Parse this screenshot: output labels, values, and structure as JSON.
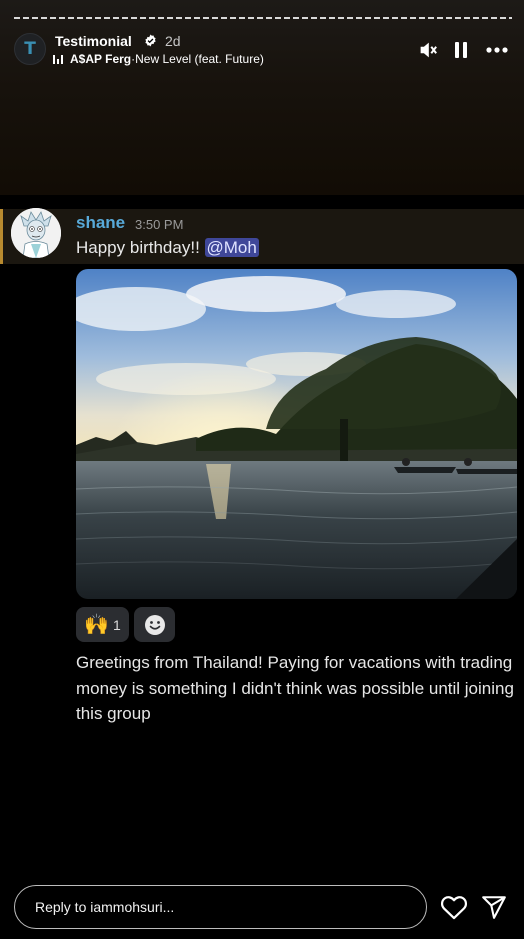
{
  "story": {
    "account_name": "Testimonial",
    "posted_ago": "2d",
    "avatar_letter": "T",
    "music": {
      "artist": "A$AP Ferg",
      "separator": " · ",
      "song": "New Level (feat. Future)"
    },
    "icons": [
      "mute-icon",
      "pause-icon",
      "more-icon"
    ]
  },
  "message": {
    "username": "shane",
    "timestamp": "3:50 PM",
    "text": "Happy birthday!! ",
    "mention": "@Moh",
    "reactions": [
      {
        "emoji": "🙌",
        "count": "1"
      },
      {
        "icon": "add-reaction-icon"
      }
    ],
    "body": "Greetings from Thailand! Paying for vacations with trading money is something I didn't think was possible until joining this group"
  },
  "reply": {
    "placeholder": "Reply to iammohsuri...",
    "icons": [
      "heart-icon",
      "send-icon"
    ]
  },
  "colors": {
    "username": "#58a9d8",
    "mention_bg": "#3f4799",
    "highlight_border": "#b88a2f",
    "background": "#000000"
  }
}
